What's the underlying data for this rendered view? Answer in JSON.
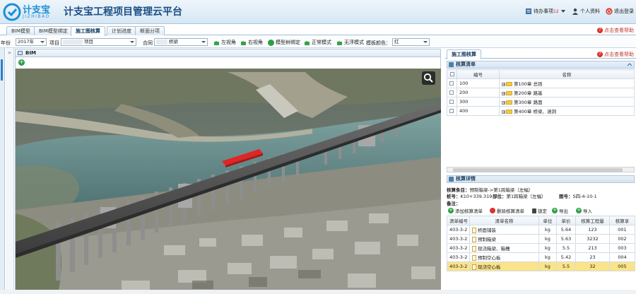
{
  "header": {
    "logo_cn": "计支宝",
    "logo_en": "JIZHIBAO",
    "title": "计支宝工程项目管理云平台",
    "todo_label": "待办事项",
    "todo_count": "12",
    "profile_label": "个人资料",
    "logout_label": "退出登录"
  },
  "tabs": [
    {
      "label": "BIM模型"
    },
    {
      "label": "BIM模型绑定"
    },
    {
      "label": "施工图核算"
    },
    {
      "label": "计划进度"
    },
    {
      "label": "断面分项"
    }
  ],
  "help_label": "点击查看帮助",
  "filters": {
    "year_label": "年份",
    "year_value": "2017年",
    "project_label": "项目",
    "project_value": "项目",
    "contract_label": "合同",
    "contract_value": "桥梁",
    "buttons": [
      "左视角",
      "右视角",
      "模型树绑定",
      "正常模式",
      "无浮模式"
    ],
    "color_label": "模板颜色：",
    "color_value": "红"
  },
  "bim_panel": {
    "title": "BIM"
  },
  "right_panel": {
    "tab_label": "施工图核算",
    "list_title": "核算清单",
    "list_columns": [
      "编号",
      "名称"
    ],
    "list_rows": [
      {
        "code": "100",
        "name": "第100章 总则"
      },
      {
        "code": "200",
        "name": "第200章 路基"
      },
      {
        "code": "300",
        "name": "第300章 路面"
      },
      {
        "code": "400",
        "name": "第400章 桥梁、涵洞"
      }
    ],
    "detail_title": "核算详情",
    "detail": {
      "item_label": "核算条目：",
      "item_value": "预制箱梁->第1跨箱梁（左幅）",
      "station_label": "桩号：",
      "station_value": "K10+339.319",
      "part_label": "部位：",
      "part_value": "第1跨箱梁（左幅）",
      "drawing_label": "图号：",
      "drawing_value": "S四-4-10-1",
      "note_label": "备注："
    },
    "actions": [
      "添加核算清单",
      "删除核算清单",
      "锁定",
      "导出",
      "导入"
    ],
    "detail_columns": [
      "清单编号",
      "清单名称",
      "单位",
      "单价",
      "核算工程量",
      "核算享"
    ],
    "detail_rows": [
      {
        "code": "403-3-2",
        "name": "桥面铺装",
        "unit": "kg",
        "price": "5.64",
        "qty": "123",
        "seq": "001"
      },
      {
        "code": "403-3-2",
        "name": "预制箱梁",
        "unit": "kg",
        "price": "5.63",
        "qty": "3232",
        "seq": "002"
      },
      {
        "code": "403-3-2",
        "name": "现浇箱梁、箱槽",
        "unit": "kg",
        "price": "5.5",
        "qty": "213",
        "seq": "003"
      },
      {
        "code": "403-3-2",
        "name": "预制空心板",
        "unit": "kg",
        "price": "5.42",
        "qty": "23",
        "seq": "004"
      },
      {
        "code": "403-3-2",
        "name": "现浇空心板",
        "unit": "kg",
        "price": "5.5",
        "qty": "32",
        "seq": "005",
        "selected": true
      }
    ]
  }
}
